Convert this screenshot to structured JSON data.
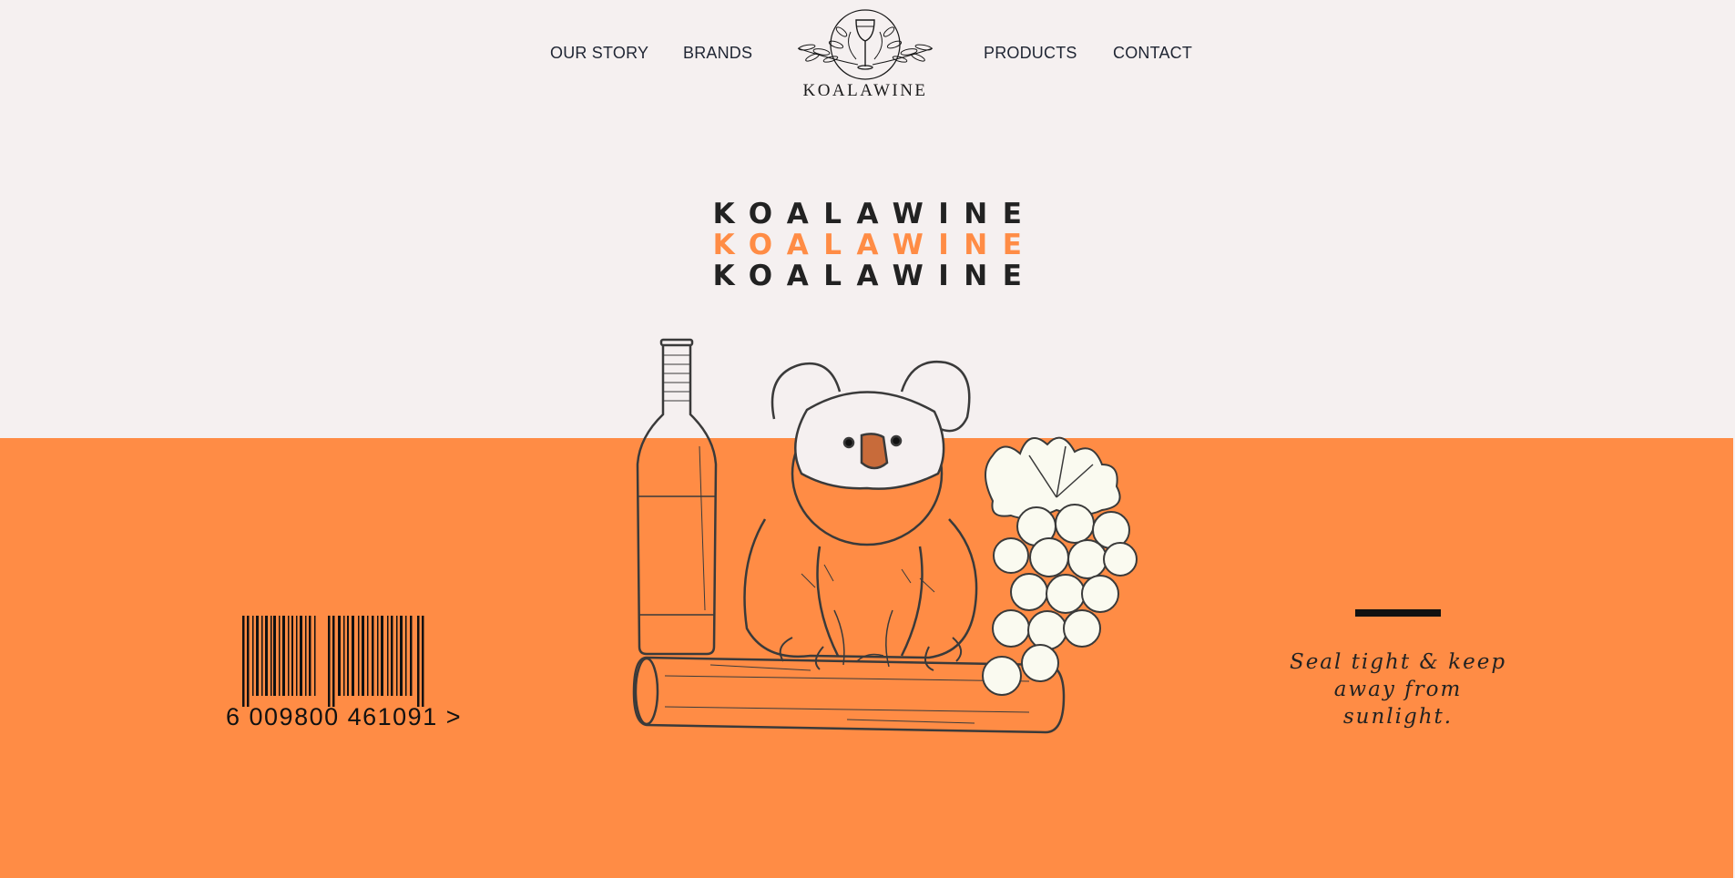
{
  "nav": {
    "items": [
      {
        "label": "OUR STORY"
      },
      {
        "label": "BRANDS"
      },
      {
        "label": "PRODUCTS"
      },
      {
        "label": "CONTACT"
      }
    ],
    "logo_text": "KOALAWINE"
  },
  "hero": {
    "lines": [
      "KOALAWINE",
      "KOALAWINE",
      "KOALAWINE"
    ]
  },
  "barcode": {
    "digits": "6 009800 461091 >"
  },
  "tagline": {
    "line1": "Seal tight & keep",
    "line2": "away from",
    "line3": "sunlight."
  },
  "colors": {
    "accent": "#ff8c45",
    "background": "#f5f0f0",
    "text": "#222222"
  },
  "icons": {
    "logo": "wine-glass-wreath-icon",
    "illustration": "koala-wine-grapes-illustration",
    "barcode": "barcode-icon"
  }
}
